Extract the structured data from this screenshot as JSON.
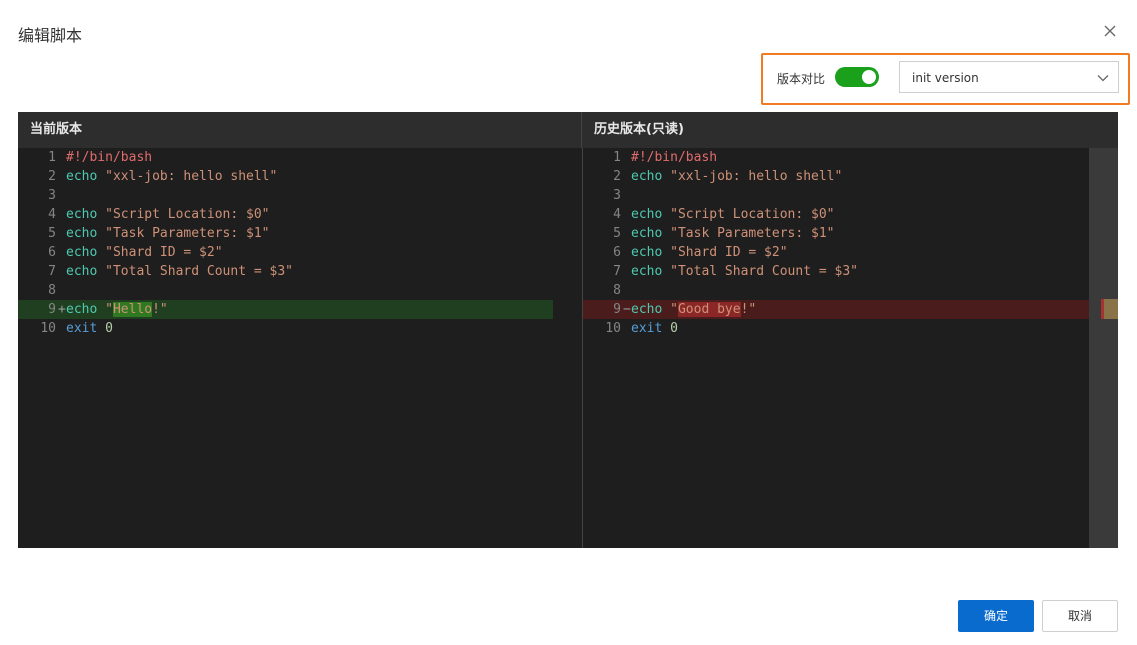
{
  "dialog": {
    "title": "编辑脚本"
  },
  "compare": {
    "label": "版本对比",
    "enabled": true,
    "selected_version": "init version"
  },
  "editor": {
    "left_title": "当前版本",
    "right_title": "历史版本(只读)",
    "left_lines": [
      {
        "n": "1",
        "mark": "",
        "parts": [
          {
            "t": "#!/bin/bash",
            "c": "cmt"
          }
        ]
      },
      {
        "n": "2",
        "mark": "",
        "parts": [
          {
            "t": "echo",
            "c": "kw"
          },
          {
            "t": " ",
            "c": ""
          },
          {
            "t": "\"xxl-job: hello shell\"",
            "c": "str"
          }
        ]
      },
      {
        "n": "3",
        "mark": "",
        "parts": []
      },
      {
        "n": "4",
        "mark": "",
        "parts": [
          {
            "t": "echo",
            "c": "kw"
          },
          {
            "t": " ",
            "c": ""
          },
          {
            "t": "\"Script Location: $0\"",
            "c": "str"
          }
        ]
      },
      {
        "n": "5",
        "mark": "",
        "parts": [
          {
            "t": "echo",
            "c": "kw"
          },
          {
            "t": " ",
            "c": ""
          },
          {
            "t": "\"Task Parameters: $1\"",
            "c": "str"
          }
        ]
      },
      {
        "n": "6",
        "mark": "",
        "parts": [
          {
            "t": "echo",
            "c": "kw"
          },
          {
            "t": " ",
            "c": ""
          },
          {
            "t": "\"Shard ID = $2\"",
            "c": "str"
          }
        ]
      },
      {
        "n": "7",
        "mark": "",
        "parts": [
          {
            "t": "echo",
            "c": "kw"
          },
          {
            "t": " ",
            "c": ""
          },
          {
            "t": "\"Total Shard Count = $3\"",
            "c": "str"
          }
        ]
      },
      {
        "n": "8",
        "mark": "",
        "parts": []
      },
      {
        "n": "9",
        "mark": "+",
        "diff": "add",
        "parts": [
          {
            "t": "echo",
            "c": "kw"
          },
          {
            "t": " ",
            "c": ""
          },
          {
            "t": "\"",
            "c": "str"
          },
          {
            "t": "Hello",
            "c": "str hl-add"
          },
          {
            "t": "!\"",
            "c": "str"
          }
        ]
      },
      {
        "n": "10",
        "mark": "",
        "parts": [
          {
            "t": "exit",
            "c": "kw2"
          },
          {
            "t": " ",
            "c": ""
          },
          {
            "t": "0",
            "c": "num"
          }
        ]
      }
    ],
    "right_lines": [
      {
        "n": "1",
        "mark": "",
        "parts": [
          {
            "t": "#!/bin/bash",
            "c": "cmt"
          }
        ]
      },
      {
        "n": "2",
        "mark": "",
        "parts": [
          {
            "t": "echo",
            "c": "kw"
          },
          {
            "t": " ",
            "c": ""
          },
          {
            "t": "\"xxl-job: hello shell\"",
            "c": "str"
          }
        ]
      },
      {
        "n": "3",
        "mark": "",
        "parts": []
      },
      {
        "n": "4",
        "mark": "",
        "parts": [
          {
            "t": "echo",
            "c": "kw"
          },
          {
            "t": " ",
            "c": ""
          },
          {
            "t": "\"Script Location: $0\"",
            "c": "str"
          }
        ]
      },
      {
        "n": "5",
        "mark": "",
        "parts": [
          {
            "t": "echo",
            "c": "kw"
          },
          {
            "t": " ",
            "c": ""
          },
          {
            "t": "\"Task Parameters: $1\"",
            "c": "str"
          }
        ]
      },
      {
        "n": "6",
        "mark": "",
        "parts": [
          {
            "t": "echo",
            "c": "kw"
          },
          {
            "t": " ",
            "c": ""
          },
          {
            "t": "\"Shard ID = $2\"",
            "c": "str"
          }
        ]
      },
      {
        "n": "7",
        "mark": "",
        "parts": [
          {
            "t": "echo",
            "c": "kw"
          },
          {
            "t": " ",
            "c": ""
          },
          {
            "t": "\"Total Shard Count = $3\"",
            "c": "str"
          }
        ]
      },
      {
        "n": "8",
        "mark": "",
        "parts": []
      },
      {
        "n": "9",
        "mark": "−",
        "diff": "del",
        "parts": [
          {
            "t": "echo",
            "c": "kw"
          },
          {
            "t": " ",
            "c": ""
          },
          {
            "t": "\"",
            "c": "str"
          },
          {
            "t": "Good bye",
            "c": "str hl-del"
          },
          {
            "t": "!\"",
            "c": "str"
          }
        ]
      },
      {
        "n": "10",
        "mark": "",
        "parts": [
          {
            "t": "exit",
            "c": "kw2"
          },
          {
            "t": " ",
            "c": ""
          },
          {
            "t": "0",
            "c": "num"
          }
        ]
      }
    ]
  },
  "footer": {
    "ok_label": "确定",
    "cancel_label": "取消"
  },
  "colors": {
    "accent": "#0a6bce",
    "toggle_on": "#1aa01a",
    "highlight_border": "#f07b20",
    "diff_add": "#1f3f20",
    "diff_del": "#4b1c1c"
  },
  "icons": {
    "close": "close-icon",
    "dropdown": "chevron-down-icon"
  }
}
